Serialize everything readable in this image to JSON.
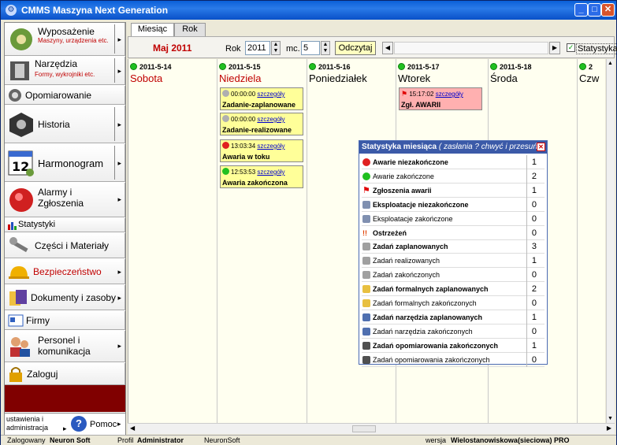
{
  "window": {
    "title": "CMMS Maszyna Next Generation"
  },
  "sidebar": {
    "items": [
      {
        "label": "Wyposażenie",
        "sub": "Maszyny, urządzenia etc."
      },
      {
        "label": "Narzędzia",
        "sub": "Formy, wykrojniki etc."
      },
      {
        "label": "Opomiarowanie"
      },
      {
        "label": "Historia"
      },
      {
        "label": "Harmonogram"
      },
      {
        "label": "Alarmy i Zgłoszenia"
      },
      {
        "label": "Statystyki"
      },
      {
        "label": "Części i Materiały"
      },
      {
        "label": "Bezpieczeństwo"
      },
      {
        "label": "Dokumenty i zasoby"
      },
      {
        "label": "Firmy"
      },
      {
        "label": "Personel i komunikacja"
      },
      {
        "label": "Zaloguj"
      }
    ],
    "settings_label": "ustawienia i administracja",
    "help_label": "Pomoc"
  },
  "tabs": [
    "Miesiąc",
    "Rok"
  ],
  "toolbar": {
    "month_label": "Maj 2011",
    "year_label": "Rok",
    "year_value": "2011",
    "month_label_short": "mc.",
    "month_value": "5",
    "read_button": "Odczytaj",
    "stats_checkbox": "Statystyka",
    "stats_checked": true
  },
  "calendar": {
    "days": [
      {
        "date": "2011-5-14",
        "name": "Sobota",
        "weekend": true
      },
      {
        "date": "2011-5-15",
        "name": "Niedziela",
        "weekend": true
      },
      {
        "date": "2011-5-16",
        "name": "Poniedziałek",
        "weekend": false
      },
      {
        "date": "2011-5-17",
        "name": "Wtorek",
        "weekend": false
      },
      {
        "date": "2011-5-18",
        "name": "Środa",
        "weekend": false
      },
      {
        "date": "2",
        "name": "Czw",
        "weekend": false
      }
    ],
    "events_day2": [
      {
        "time": "00:00:00",
        "link": "szczegóły",
        "name": "Zadanie-zaplanowane"
      },
      {
        "time": "00:00:00",
        "link": "szczegóły",
        "name": "Zadanie-realizowane"
      },
      {
        "time": "13:03:34",
        "link": "szczegóły",
        "name": "Awaria w toku"
      },
      {
        "time": "12:53:53",
        "link": "szczegóły",
        "name": "Awaria zakończona"
      }
    ],
    "events_day4": [
      {
        "time": "15:17:02",
        "link": "szczegóły",
        "name": "Zgł. AWARII"
      }
    ]
  },
  "stats": {
    "title": "Statystyka miesiąca",
    "hint": "( zasłania ? chwyć i przesuń )",
    "rows": [
      {
        "label": "Awarie niezakończone",
        "value": "1",
        "bold": true,
        "icon": "red-circle-icon"
      },
      {
        "label": "Awarie zakończone",
        "value": "2",
        "bold": false,
        "icon": "green-circle-icon"
      },
      {
        "label": "Zgłoszenia awarii",
        "value": "1",
        "bold": true,
        "icon": "red-flag-icon"
      },
      {
        "label": "Eksploatacje niezakończone",
        "value": "0",
        "bold": true,
        "icon": "exploit-icon"
      },
      {
        "label": "Eksploatacje zakończone",
        "value": "0",
        "bold": false,
        "icon": "exploit-icon"
      },
      {
        "label": "Ostrzeżeń",
        "value": "0",
        "bold": true,
        "icon": "warning-icon"
      },
      {
        "label": "Zadań zaplanowanych",
        "value": "3",
        "bold": true,
        "icon": "gear-icon"
      },
      {
        "label": "Zadań realizowanych",
        "value": "1",
        "bold": false,
        "icon": "gear-icon"
      },
      {
        "label": "Zadań zakończonych",
        "value": "0",
        "bold": false,
        "icon": "gear-icon"
      },
      {
        "label": "Zadań formalnych zaplanowanych",
        "value": "2",
        "bold": true,
        "icon": "document-icon"
      },
      {
        "label": "Zadań formalnych zakończonych",
        "value": "0",
        "bold": false,
        "icon": "document-icon"
      },
      {
        "label": "Zadań narzędzia zaplanowanych",
        "value": "1",
        "bold": true,
        "icon": "tool-icon"
      },
      {
        "label": "Zadań narzędzia zakończonych",
        "value": "0",
        "bold": false,
        "icon": "tool-icon"
      },
      {
        "label": "Zadań opomiarowania zakończonych",
        "value": "1",
        "bold": true,
        "icon": "meter-icon"
      },
      {
        "label": "Zadań opomiarowania zakończonych",
        "value": "0",
        "bold": false,
        "icon": "meter-icon"
      }
    ]
  },
  "statusbar": {
    "user": "Zalogowany",
    "user_name": "Neuron Soft",
    "profile": "Profil",
    "profile_name": "Administrator",
    "company": "NeuronSoft",
    "version": "wersja",
    "version_name": "Wielostanowiskowa(sieciowa) PRO"
  },
  "colors": {
    "accent": "#3b5aa8",
    "weekend": "#c00000",
    "dark_panel": "#800000"
  }
}
